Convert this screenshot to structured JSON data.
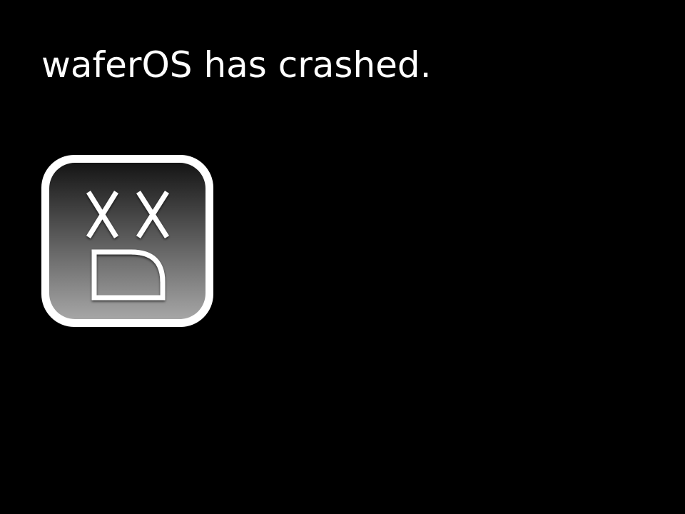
{
  "screen": {
    "background": "#000000",
    "message": "waferOS has crashed."
  },
  "crash_icon": {
    "icon": "sad-face-crash-icon",
    "border_color": "#ffffff",
    "gradient_top": "#151515",
    "gradient_bottom": "#a6a6a6",
    "face_color": "#ffffff"
  }
}
